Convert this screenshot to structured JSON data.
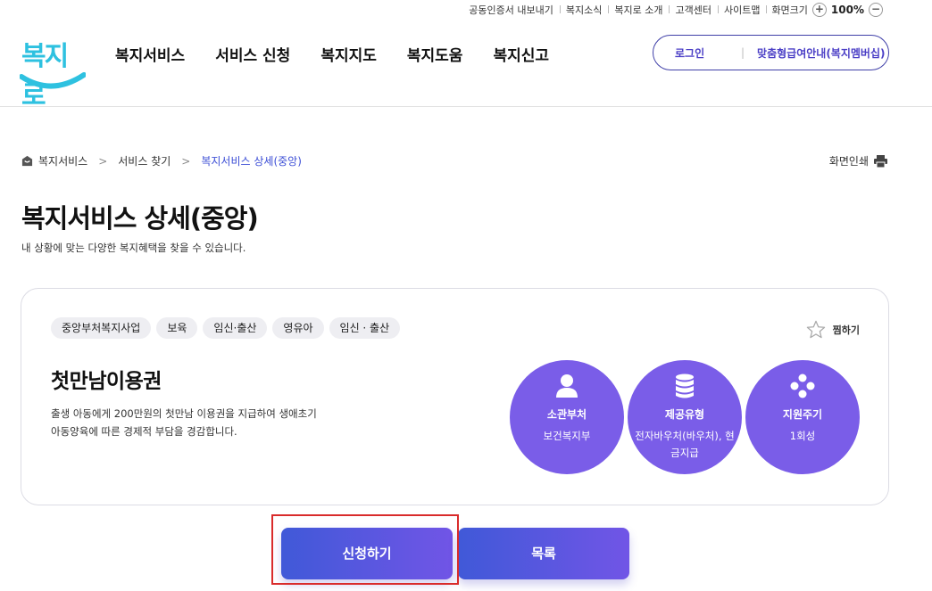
{
  "util": {
    "items": [
      "공동인증서 내보내기",
      "복지소식",
      "복지로 소개",
      "고객센터",
      "사이트맵"
    ],
    "zoom_label": "화면크기",
    "zoom_in": "+",
    "zoom_value": "100%",
    "zoom_out": "−"
  },
  "header": {
    "logo_text": "복지로",
    "nav": [
      "복지서비스",
      "서비스 신청",
      "복지지도",
      "복지도움",
      "복지신고"
    ],
    "login": "로그인",
    "separator": "|",
    "guide": "맞춤형급여안내(복지멤버십)"
  },
  "breadcrumb": {
    "items": [
      "복지서비스",
      "서비스 찾기",
      "복지서비스 상세(중앙)"
    ],
    "separator": ">"
  },
  "print_label": "화면인쇄",
  "page": {
    "title": "복지서비스 상세(중앙)",
    "subtitle": "내 상황에 맞는 다양한 복지혜택을 찾을 수 있습니다."
  },
  "service": {
    "tags": [
      "중앙부처복지사업",
      "보육",
      "임신·출산",
      "영유아",
      "임신 · 출산"
    ],
    "favorite_label": "찜하기",
    "name": "첫만남이용권",
    "description": "출생 아동에게 200만원의 첫만남 이용권을 지급하여 생애초기 아동양육에 따른 경제적 부담을 경감합니다.",
    "info": [
      {
        "label": "소관부처",
        "value": "보건복지부",
        "icon": "person-icon"
      },
      {
        "label": "제공유형",
        "value": "전자바우처(바우처), 현금지급",
        "icon": "database-icon"
      },
      {
        "label": "지원주기",
        "value": "1회성",
        "icon": "dots-icon"
      }
    ]
  },
  "buttons": {
    "apply": "신청하기",
    "list": "목록"
  },
  "colors": {
    "accent": "#7a5de8",
    "button_start": "#4059d8",
    "button_end": "#7155e6",
    "highlight": "#d92b2b"
  }
}
